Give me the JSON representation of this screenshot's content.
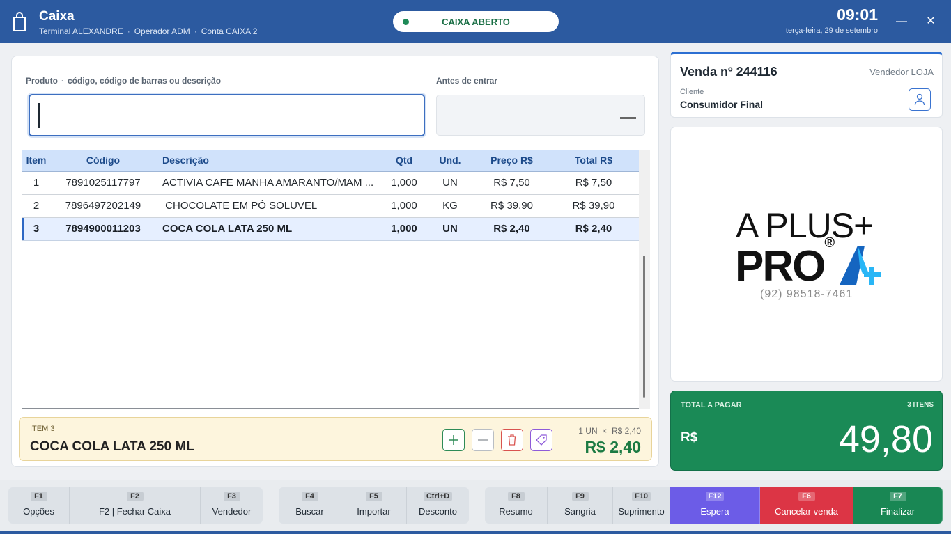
{
  "header": {
    "title": "Caixa",
    "terminal": "Terminal ALEXANDRE",
    "operator": "Operador ADM",
    "account": "Conta CAIXA 2",
    "separator": "·",
    "status": "CAIXA ABERTO",
    "time": "09:01",
    "date": "terça-feira, 29 de setembro",
    "minimize": "—",
    "close": "✕"
  },
  "form": {
    "product_label": "Produto",
    "product_hint": "código, código de barras ou descrição",
    "product_value": "",
    "preview_label": "Antes de entrar"
  },
  "table": {
    "columns": [
      "Item",
      "Código",
      "Descrição",
      "Qtd",
      "Und.",
      "Preço R$",
      "Total R$"
    ],
    "rows": [
      {
        "item": "1",
        "code": "7891025117797",
        "desc": "ACTIVIA CAFE MANHA AMARANTO/MAM ...",
        "qty": "1,000",
        "unit": "UN",
        "price": "R$ 7,50",
        "total": "R$ 7,50"
      },
      {
        "item": "2",
        "code": "7896497202149",
        "desc": " CHOCOLATE EM PÓ SOLUVEL",
        "qty": "1,000",
        "unit": "KG",
        "price": "R$ 39,90",
        "total": "R$ 39,90"
      },
      {
        "item": "3",
        "code": "7894900011203",
        "desc": "COCA COLA LATA 250 ML",
        "qty": "1,000",
        "unit": "UN",
        "price": "R$ 2,40",
        "total": "R$ 2,40"
      }
    ]
  },
  "current_item": {
    "tag": "ITEM 3",
    "name": "COCA COLA LATA 250 ML",
    "calc": "1 UN  ×  R$ 2,40",
    "total": "R$ 2,40"
  },
  "sale": {
    "title": "Venda nº 244116",
    "vendor": "Vendedor LOJA",
    "client_label": "Cliente",
    "client": "Consumidor Final"
  },
  "logo": {
    "line1": "A PLUS+",
    "line2": "PRO",
    "registered": "®",
    "phone": "(92) 98518-7461",
    "colors": {
      "dark_blue": "#1565c0",
      "light_blue": "#29b6f6"
    }
  },
  "totals": {
    "label": "TOTAL A PAGAR",
    "count": "3 ITENS",
    "currency": "R$",
    "value": "49,80"
  },
  "footer": {
    "keys": [
      {
        "key": "F1",
        "label": "Opções"
      },
      {
        "key": "F2",
        "label": "F2 | Fechar Caixa"
      },
      {
        "key": "F3",
        "label": "Vendedor"
      },
      {
        "key": "F4",
        "label": "Buscar"
      },
      {
        "key": "F5",
        "label": "Importar"
      },
      {
        "key": "Ctrl+D",
        "label": "Desconto"
      },
      {
        "key": "F8",
        "label": "Resumo"
      },
      {
        "key": "F9",
        "label": "Sangria"
      },
      {
        "key": "F10",
        "label": "Suprimento"
      },
      {
        "key": "F12",
        "label": "Espera"
      },
      {
        "key": "F6",
        "label": "Cancelar venda"
      },
      {
        "key": "F7",
        "label": "Finalizar"
      }
    ]
  },
  "colors": {
    "header": "#2c5aa0",
    "status_green": "#1a6f45",
    "total_green": "#1a8a56",
    "espera": "#6c5ce7",
    "cancelar": "#dc3545",
    "finalizar": "#198754"
  }
}
